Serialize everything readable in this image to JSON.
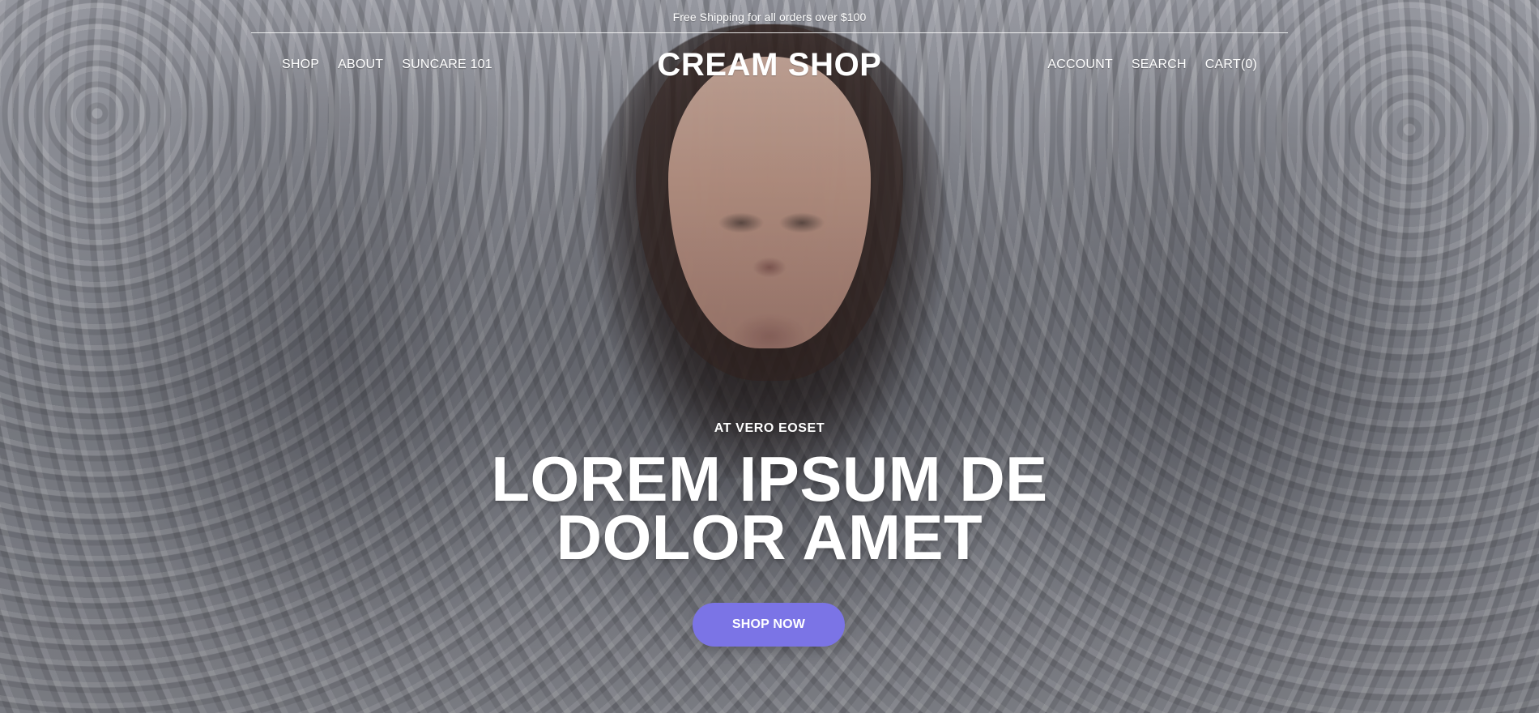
{
  "announcement": {
    "text": "Free Shipping for all orders over $100"
  },
  "header": {
    "logo": "CREAM SHOP",
    "left_nav": [
      {
        "label": "SHOP"
      },
      {
        "label": "ABOUT"
      },
      {
        "label": "SUNCARE 101"
      }
    ],
    "right_nav": [
      {
        "label": "ACCOUNT"
      },
      {
        "label": "SEARCH"
      },
      {
        "label": "CART(0)"
      }
    ]
  },
  "hero": {
    "kicker": "AT VERO EOSET",
    "headline_lines": [
      "LOREM IPSUM DE",
      "DOLOR AMET"
    ],
    "cta_label": "SHOP NOW",
    "colors": {
      "cta_bg": "#7B74E6",
      "text": "#FFFFFF"
    }
  }
}
